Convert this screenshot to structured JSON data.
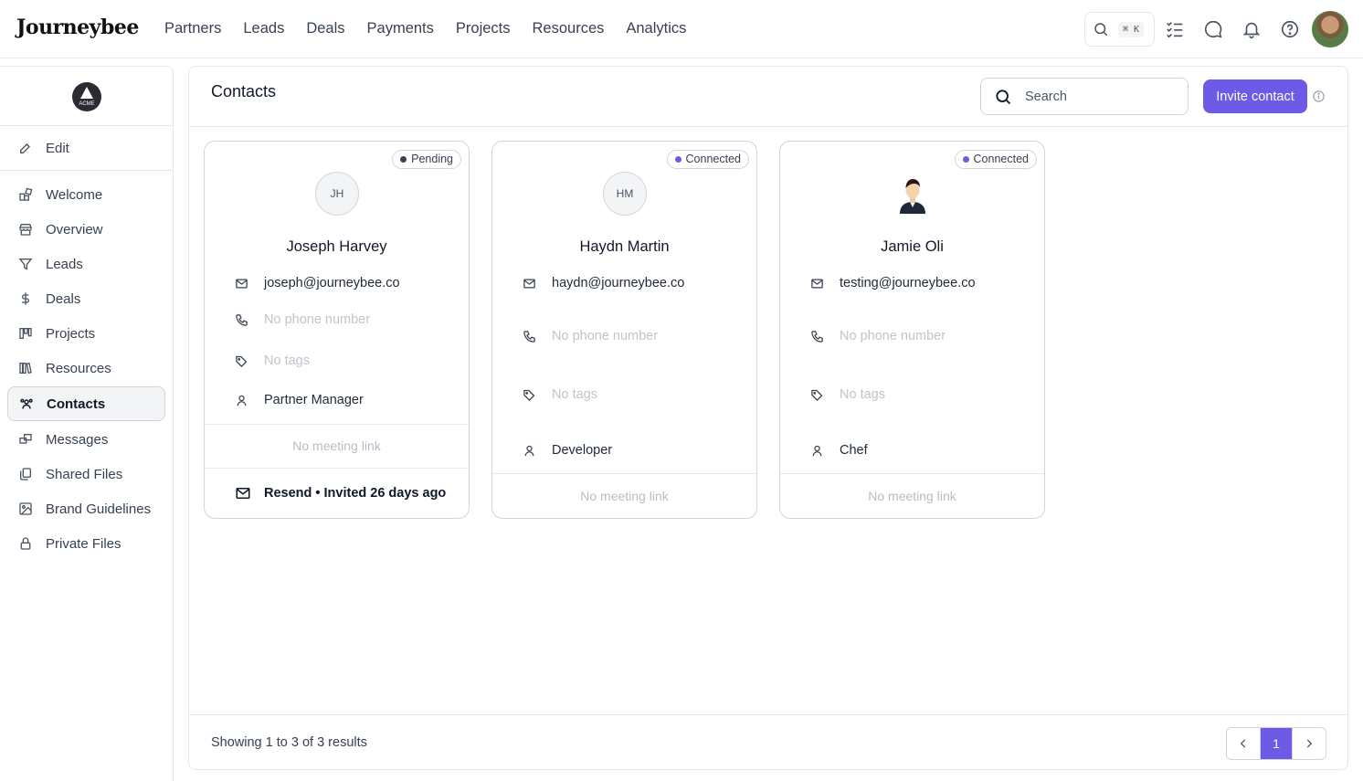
{
  "header": {
    "brand": "Journeybee",
    "nav": [
      "Partners",
      "Leads",
      "Deals",
      "Payments",
      "Projects",
      "Resources",
      "Analytics"
    ],
    "search_shortcut": "⌘ K"
  },
  "sidebar": {
    "org_logo_text": "ACME",
    "edit_label": "Edit",
    "items": [
      {
        "label": "Welcome",
        "icon": "welcome-icon"
      },
      {
        "label": "Overview",
        "icon": "store-icon"
      },
      {
        "label": "Leads",
        "icon": "filter-icon"
      },
      {
        "label": "Deals",
        "icon": "dollar-icon"
      },
      {
        "label": "Projects",
        "icon": "kanban-icon"
      },
      {
        "label": "Resources",
        "icon": "library-icon"
      },
      {
        "label": "Contacts",
        "icon": "users-icon",
        "active": true
      },
      {
        "label": "Messages",
        "icon": "messages-icon"
      },
      {
        "label": "Shared Files",
        "icon": "files-icon"
      },
      {
        "label": "Brand Guidelines",
        "icon": "image-icon"
      },
      {
        "label": "Private Files",
        "icon": "lock-icon"
      }
    ]
  },
  "main": {
    "title": "Contacts",
    "search_placeholder": "Search",
    "invite_label": "Invite contact",
    "cards": [
      {
        "status": "Pending",
        "status_color": "#374151",
        "initials": "JH",
        "name": "Joseph Harvey",
        "email": "joseph@journeybee.co",
        "phone": "No phone number",
        "tags": "No tags",
        "role": "Partner Manager",
        "meeting": "No meeting link",
        "resend": "Resend • Invited 26 days ago"
      },
      {
        "status": "Connected",
        "status_color": "#6d5ae6",
        "initials": "HM",
        "name": "Haydn Martin",
        "email": "haydn@journeybee.co",
        "phone": "No phone number",
        "tags": "No tags",
        "role": "Developer",
        "meeting": "No meeting link"
      },
      {
        "status": "Connected",
        "status_color": "#6d5ae6",
        "initials": "",
        "name": "Jamie Oli",
        "email": "testing@journeybee.co",
        "phone": "No phone number",
        "tags": "No tags",
        "role": "Chef",
        "meeting": "No meeting link"
      }
    ],
    "results_text": "Showing 1 to 3 of 3 results",
    "current_page": "1"
  },
  "colors": {
    "accent": "#6d5ae6",
    "border": "#e5e7eb"
  }
}
